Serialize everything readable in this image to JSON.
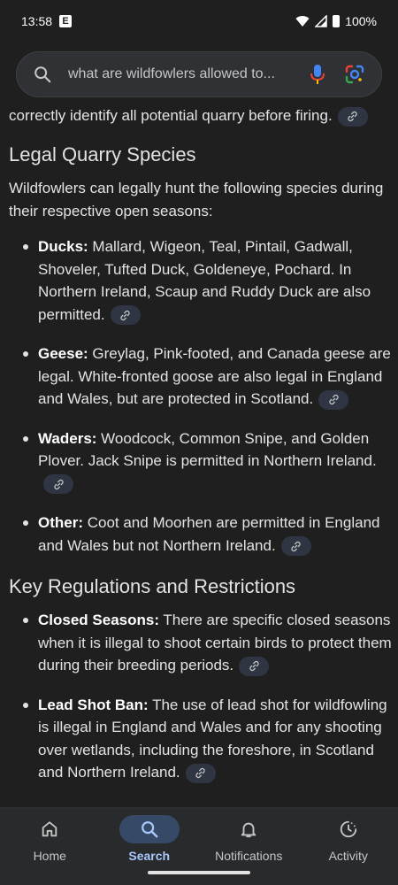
{
  "status_bar": {
    "time": "13:58",
    "app_badge": "E",
    "battery": "100%"
  },
  "search": {
    "query": "what are wildfowlers allowed to..."
  },
  "article": {
    "lead_line": "correctly identify all potential quarry before firing.",
    "section1": {
      "heading": "Legal Quarry Species",
      "intro": "Wildfowlers can legally hunt the following species during their respective open seasons:",
      "items": [
        {
          "term": "Ducks:",
          "text": " Mallard, Wigeon, Teal, Pintail, Gadwall, Shoveler, Tufted Duck, Goldeneye, Pochard. In Northern Ireland, Scaup and Ruddy Duck are also permitted."
        },
        {
          "term": "Geese:",
          "text": " Greylag, Pink-footed, and Canada geese are legal. White-fronted goose are also legal in England and Wales, but are protected in Scotland."
        },
        {
          "term": "Waders:",
          "text": " Woodcock, Common Snipe, and Golden Plover. Jack Snipe is permitted in Northern Ireland."
        },
        {
          "term": "Other:",
          "text": " Coot and Moorhen are permitted in England and Wales but not Northern Ireland."
        }
      ]
    },
    "section2": {
      "heading": "Key Regulations and Restrictions",
      "items": [
        {
          "term": "Closed Seasons:",
          "text": " There are specific closed seasons when it is illegal to shoot certain birds to protect them during their breeding periods."
        },
        {
          "term": "Lead Shot Ban:",
          "text": " The use of lead shot for wildfowling is illegal in England and Wales and for any shooting over wetlands, including the foreshore, in Scotland and Northern Ireland."
        }
      ]
    }
  },
  "bottom_nav": {
    "items": [
      {
        "label": "Home",
        "icon": "home-icon"
      },
      {
        "label": "Search",
        "icon": "search-icon",
        "active": true
      },
      {
        "label": "Notifications",
        "icon": "bell-icon"
      },
      {
        "label": "Activity",
        "icon": "activity-icon"
      }
    ]
  },
  "colors": {
    "background": "#1f1f1f",
    "search_bar": "#303134",
    "accent": "#a8c7fa",
    "active_pill": "#364a67",
    "link_chip": "#2f3542"
  }
}
